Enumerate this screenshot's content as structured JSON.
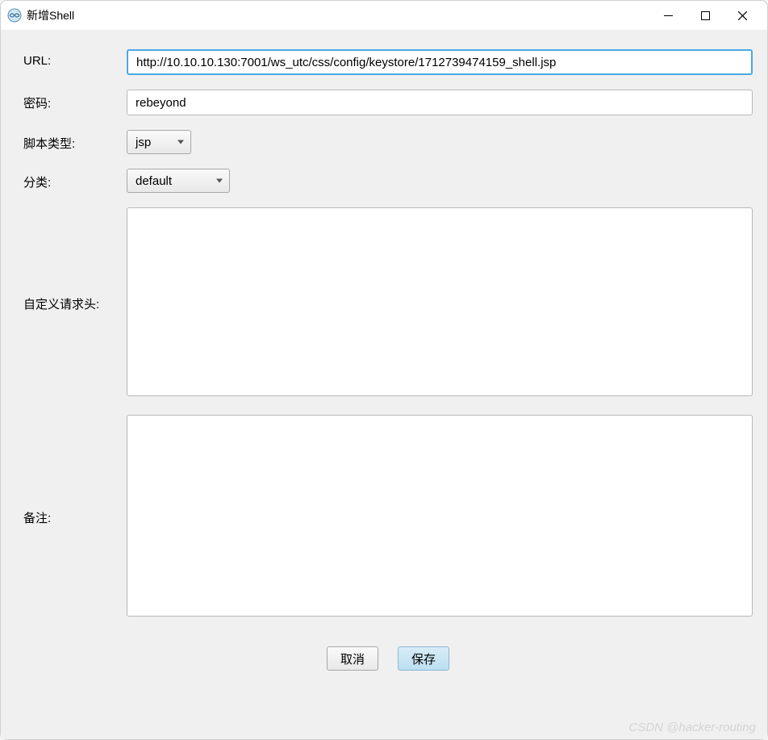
{
  "window": {
    "title": "新增Shell"
  },
  "form": {
    "url_label": "URL:",
    "url_value": "http://10.10.10.130:7001/ws_utc/css/config/keystore/1712739474159_shell.jsp",
    "password_label": "密码:",
    "password_value": "rebeyond",
    "script_type_label": "脚本类型:",
    "script_type_value": "jsp",
    "category_label": "分类:",
    "category_value": "default",
    "custom_headers_label": "自定义请求头:",
    "custom_headers_value": "",
    "notes_label": "备注:",
    "notes_value": ""
  },
  "buttons": {
    "cancel": "取消",
    "save": "保存"
  },
  "watermark": "CSDN @hacker-routing"
}
